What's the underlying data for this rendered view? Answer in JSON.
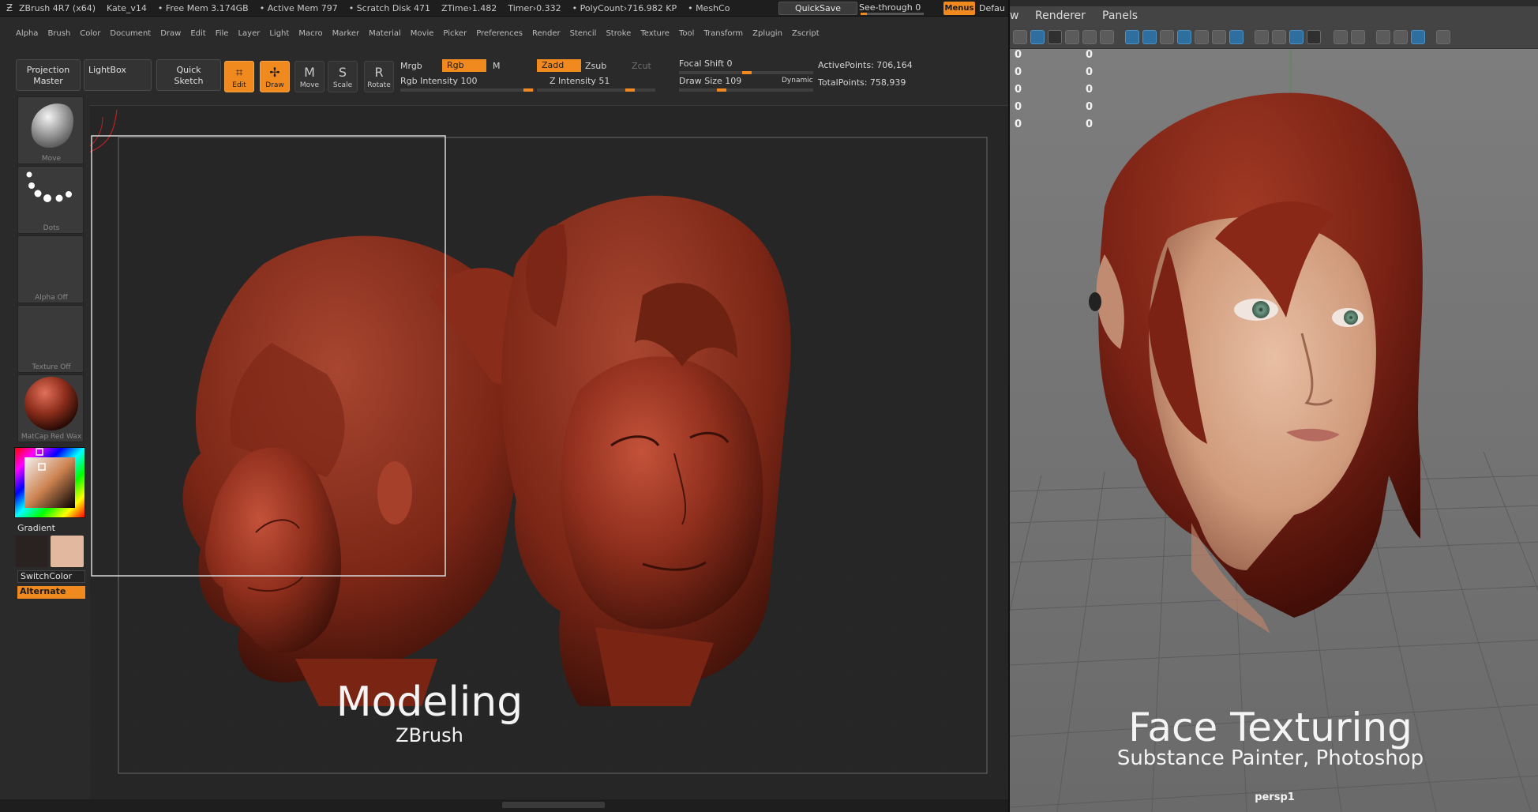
{
  "zbrush": {
    "title_bar": {
      "app": "ZBrush 4R7 (x64)",
      "file": "Kate_v14",
      "stats": [
        "• Free Mem 3.174GB",
        "• Active Mem 797",
        "• Scratch Disk 471",
        "ZTime›1.482",
        "Timer›0.332",
        "• PolyCount›716.982 KP",
        "• MeshCo"
      ],
      "quicksave": "QuickSave",
      "see_through": "See-through  0",
      "see_through_value": 0.1,
      "menus": "Menus",
      "default": "Defau"
    },
    "menu_bar": [
      "Alpha",
      "Brush",
      "Color",
      "Document",
      "Draw",
      "Edit",
      "File",
      "Layer",
      "Light",
      "Macro",
      "Marker",
      "Material",
      "Movie",
      "Picker",
      "Preferences",
      "Render",
      "Stencil",
      "Stroke",
      "Texture",
      "Tool",
      "Transform",
      "Zplugin",
      "Zscript"
    ],
    "shelf": {
      "projection_master": "Projection\nMaster",
      "lightbox": "LightBox",
      "quick_sketch": "Quick\nSketch",
      "edit": "Edit",
      "draw": "Draw",
      "move": "Move",
      "scale": "Scale",
      "rotate": "Rotate",
      "mrgb": "Mrgb",
      "rgb": "Rgb",
      "m": "M",
      "zadd": "Zadd",
      "zsub": "Zsub",
      "zcut": "Zcut",
      "rgb_intensity": "Rgb  Intensity 100",
      "z_intensity": "Z  Intensity 51",
      "focal_shift": "Focal Shift 0",
      "draw_size": "Draw Size 109",
      "dynamic": "Dynamic",
      "active_points": "ActivePoints: 706,164",
      "total_points": "TotalPoints: 758,939"
    },
    "left_tray": {
      "brush_caption": "Move",
      "stroke_caption": "Dots",
      "alpha_caption": "Alpha Off",
      "texture_caption": "Texture Off",
      "material_caption": "MatCap Red Wax",
      "gradient": "Gradient",
      "switch_color": "SwitchColor",
      "alternate": "Alternate"
    },
    "caption": {
      "title": "Modeling",
      "subtitle": "ZBrush"
    }
  },
  "maya": {
    "menu": [
      "w",
      "Renderer",
      "Panels"
    ],
    "hud_rows": [
      [
        "0",
        "0"
      ],
      [
        "0",
        "0"
      ],
      [
        "0",
        "0"
      ],
      [
        "0",
        "0"
      ],
      [
        "0",
        "0"
      ]
    ],
    "camera": "persp1",
    "caption": {
      "title": "Face Texturing",
      "subtitle": "Substance Painter, Photoshop"
    }
  },
  "colors": {
    "accent": "#f08a1e",
    "clay": "#8e2e1c",
    "skin": "#d9a88a",
    "hair": "#7b2215",
    "eye": "#6f9a86"
  }
}
